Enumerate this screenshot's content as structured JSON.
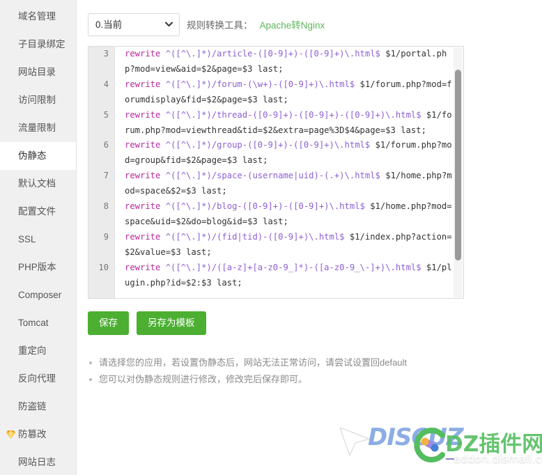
{
  "sidebar": {
    "items": [
      {
        "label": "域名管理",
        "active": false,
        "icon": null
      },
      {
        "label": "子目录绑定",
        "active": false,
        "icon": null
      },
      {
        "label": "网站目录",
        "active": false,
        "icon": null
      },
      {
        "label": "访问限制",
        "active": false,
        "icon": null
      },
      {
        "label": "流量限制",
        "active": false,
        "icon": null
      },
      {
        "label": "伪静态",
        "active": true,
        "icon": null
      },
      {
        "label": "默认文档",
        "active": false,
        "icon": null
      },
      {
        "label": "配置文件",
        "active": false,
        "icon": null
      },
      {
        "label": "SSL",
        "active": false,
        "icon": null
      },
      {
        "label": "PHP版本",
        "active": false,
        "icon": null
      },
      {
        "label": "Composer",
        "active": false,
        "icon": null
      },
      {
        "label": "Tomcat",
        "active": false,
        "icon": null
      },
      {
        "label": "重定向",
        "active": false,
        "icon": null
      },
      {
        "label": "反向代理",
        "active": false,
        "icon": null
      },
      {
        "label": "防盗链",
        "active": false,
        "icon": null
      },
      {
        "label": "防篡改",
        "active": false,
        "icon": "gem-icon"
      },
      {
        "label": "网站日志",
        "active": false,
        "icon": null
      }
    ]
  },
  "toolbar": {
    "select_value": "0.当前",
    "select_options": [
      "0.当前"
    ],
    "converter_label": "规则转换工具：",
    "converter_link": "Apache转Nginx",
    "link_color": "#5cb85c"
  },
  "editor": {
    "lines": [
      {
        "number": "3",
        "segments": [
          {
            "t": "rewrite ",
            "c": "kw"
          },
          {
            "t": "^([^\\.]*)/article-([0-9]+)-([0-9]+)\\.html$",
            "c": "re"
          },
          {
            "t": " $1/portal.php?mod=view&aid=$2&page=$3 last;",
            "c": "pl"
          }
        ]
      },
      {
        "number": "4",
        "segments": [
          {
            "t": "rewrite ",
            "c": "kw"
          },
          {
            "t": "^([^\\.]*)/forum-(\\w+)-([0-9]+)\\.html$",
            "c": "re"
          },
          {
            "t": " $1/forum.php?mod=forumdisplay&fid=$2&page=$3 last;",
            "c": "pl"
          }
        ]
      },
      {
        "number": "5",
        "segments": [
          {
            "t": "rewrite ",
            "c": "kw"
          },
          {
            "t": "^([^\\.]*)/thread-([0-9]+)-([0-9]+)-([0-9]+)\\.html$",
            "c": "re"
          },
          {
            "t": " $1/forum.php?mod=viewthread&tid=$2&extra=page%3D$4&page=$3 last;",
            "c": "pl"
          }
        ]
      },
      {
        "number": "6",
        "segments": [
          {
            "t": "rewrite ",
            "c": "kw"
          },
          {
            "t": "^([^\\.]*)/group-([0-9]+)-([0-9]+)\\.html$",
            "c": "re"
          },
          {
            "t": " $1/forum.php?mod=group&fid=$2&page=$3 last;",
            "c": "pl"
          }
        ]
      },
      {
        "number": "7",
        "segments": [
          {
            "t": "rewrite ",
            "c": "kw"
          },
          {
            "t": "^([^\\.]*)/space-(username|uid)-(.+)\\.html$",
            "c": "re"
          },
          {
            "t": " $1/home.php?mod=space&$2=$3 last;",
            "c": "pl"
          }
        ]
      },
      {
        "number": "8",
        "segments": [
          {
            "t": "rewrite ",
            "c": "kw"
          },
          {
            "t": "^([^\\.]*)/blog-([0-9]+)-([0-9]+)\\.html$",
            "c": "re"
          },
          {
            "t": " $1/home.php?mod=space&uid=$2&do=blog&id=$3 last;",
            "c": "pl"
          }
        ]
      },
      {
        "number": "9",
        "segments": [
          {
            "t": "rewrite ",
            "c": "kw"
          },
          {
            "t": "^([^\\.]*)/(fid|tid)-([0-9]+)\\.html$",
            "c": "re"
          },
          {
            "t": " $1/index.php?action=$2&value=$3 last;",
            "c": "pl"
          }
        ]
      },
      {
        "number": "10",
        "segments": [
          {
            "t": "rewrite ",
            "c": "kw"
          },
          {
            "t": "^([^\\.]*)/([a-z]+[a-z0-9_]*)-([a-z0-9_\\-]+)\\.html$",
            "c": "re"
          },
          {
            "t": " $1/plugin.php?id=$2:$3 last;",
            "c": "pl"
          }
        ]
      }
    ],
    "scroll_thumb_top_pct": 9,
    "scroll_thumb_height_pct": 76
  },
  "actions": {
    "save_label": "保存",
    "save_as_template_label": "另存为模板",
    "button_color": "#4caf32"
  },
  "help": {
    "items": [
      "请选择您的应用，若设置伪静态后，网站无法正常访问，请尝试设置回default",
      "您可以对伪静态规则进行修改，修改完后保存即可。"
    ]
  },
  "watermark": {
    "brand": "DISCUZ",
    "suffix": "DZ插件网",
    "url": "addon.dismall.com",
    "brand_color": "#4a7fd6",
    "suffix_color": "#3cb44a"
  }
}
